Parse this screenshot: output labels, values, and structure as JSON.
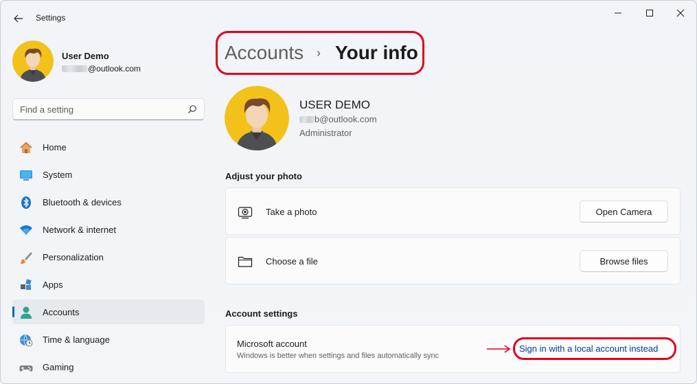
{
  "window": {
    "title": "Settings",
    "controls": [
      "minimize",
      "maximize",
      "close"
    ]
  },
  "profile": {
    "name": "User Demo",
    "email_suffix": "@outlook.com"
  },
  "search": {
    "placeholder": "Find a setting"
  },
  "nav": {
    "items": [
      {
        "label": "Home",
        "icon": "home-icon"
      },
      {
        "label": "System",
        "icon": "system-icon"
      },
      {
        "label": "Bluetooth & devices",
        "icon": "bluetooth-icon"
      },
      {
        "label": "Network & internet",
        "icon": "wifi-icon"
      },
      {
        "label": "Personalization",
        "icon": "brush-icon"
      },
      {
        "label": "Apps",
        "icon": "apps-icon"
      },
      {
        "label": "Accounts",
        "icon": "person-icon",
        "active": true
      },
      {
        "label": "Time & language",
        "icon": "globe-clock-icon"
      },
      {
        "label": "Gaming",
        "icon": "gamepad-icon"
      }
    ]
  },
  "breadcrumb": {
    "parent": "Accounts",
    "separator": "›",
    "current": "Your info"
  },
  "user": {
    "display_name": "USER DEMO",
    "email_suffix": "b@outlook.com",
    "role": "Administrator"
  },
  "photo_section": {
    "title": "Adjust your photo",
    "take_photo_label": "Take a photo",
    "take_photo_button": "Open Camera",
    "choose_file_label": "Choose a file",
    "choose_file_button": "Browse files"
  },
  "account_section": {
    "title": "Account settings",
    "ms_account_title": "Microsoft account",
    "ms_account_subtitle": "Windows is better when settings and files automatically sync",
    "local_account_link": "Sign in with a local account instead"
  },
  "colors": {
    "accent": "#0067c0",
    "highlight": "#e3001b",
    "link": "#003e92"
  }
}
